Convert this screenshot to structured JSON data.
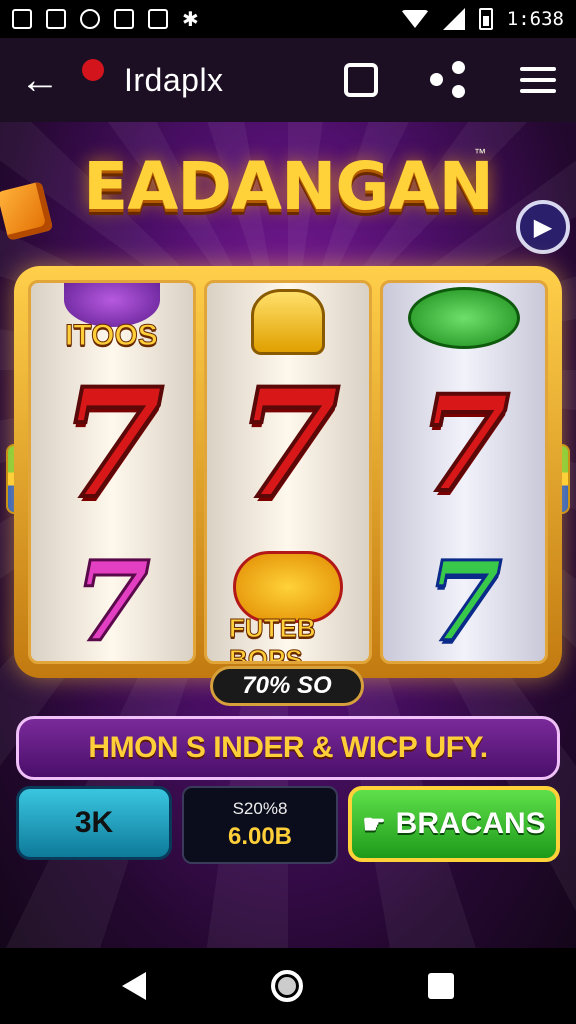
{
  "status_bar": {
    "time": "1:638"
  },
  "app_bar": {
    "title": "Irdaplx"
  },
  "game": {
    "logo": "EADANGAN",
    "trademark": "™",
    "reels": [
      {
        "top_label": "ITOOS",
        "middle": "7",
        "bottom": "7"
      },
      {
        "middle": "7",
        "bottom_label": "FUTEB BOPS"
      },
      {
        "middle": "7",
        "bottom": "7"
      }
    ],
    "win_amount": "70% SO",
    "banner": "HMON S INDER & WICP UFY.",
    "bet_button": "3K",
    "balance": {
      "label": "S20%8",
      "amount": "6.00B"
    },
    "spin_button": "BRACANS"
  },
  "colors": {
    "accent_gold": "#ffd23a",
    "spin_green": "#3ec83a",
    "bet_cyan": "#2ab6d0",
    "bg_purple": "#4d0f6a"
  }
}
